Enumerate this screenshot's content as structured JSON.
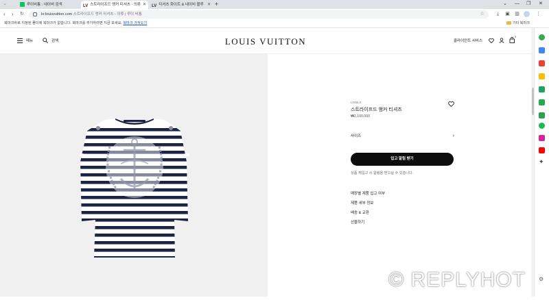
{
  "browser": {
    "tabs": [
      {
        "title": "루이비통 : 네이버 검색",
        "active": false,
        "favicon_color": "#03c75a"
      },
      {
        "title": "스트라이프드 앵커 티셔츠 - 의류",
        "active": true,
        "favicon_color": "#3b2a1a"
      },
      {
        "title": "티셔츠 화이트 & 네이비 블루",
        "active": false,
        "favicon_color": "#3b2a1a"
      }
    ],
    "new_tab_label": "+",
    "address": {
      "domain": "kr.louisvuitton.com",
      "page_title": " 스트라이프드 앵커 티셔츠 - 의류 | 루이 비통"
    },
    "bookmark_bar": {
      "message": "북마크바로 지정된 폴더에 북마크가 없습니다. 북마크를 추가하려면 지금 보세요. ",
      "link": "북마크 가져오기",
      "other_folder": "기타 북마크"
    }
  },
  "header": {
    "menu_label": "메뉴",
    "search_label": "검색",
    "logo": "LOUIS VUITTON",
    "client_service": "클라이언트 서비스",
    "cart_count": "0"
  },
  "product": {
    "brand_line": "LVM/LS",
    "name": "스트라이프드 앵커 티셔츠",
    "price": "₩2,100,000",
    "size_label": "사이즈",
    "notify_button": "입고 알림 받기",
    "stock_note": "상품 재입고 시 알림을 받으실 수 있습니다.",
    "accordion": [
      "매장별 제품 입고 여부",
      "제품 세부 정보",
      "배송 & 교환",
      "선물하기"
    ]
  },
  "colors": {
    "stripe": "#1c2344",
    "shirt": "#ffffff",
    "panel_bg": "#f0f0f0",
    "button_bg": "#0d0d0d"
  },
  "icons": {
    "menu": "hamburger-icon",
    "search": "search-icon",
    "wishlist": "heart-icon",
    "account": "person-icon",
    "cart": "bag-icon"
  },
  "watermark": "© REPLYHOT"
}
